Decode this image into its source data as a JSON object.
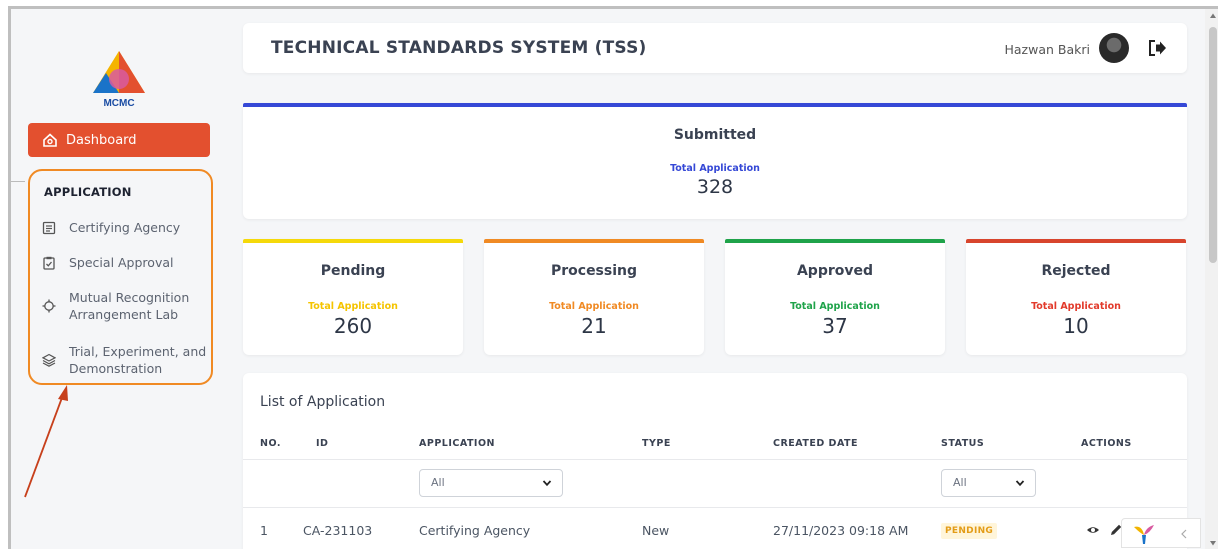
{
  "brand": {
    "logo_text": "MCMC"
  },
  "sidebar": {
    "dashboard_label": "Dashboard",
    "section_title": "APPLICATION",
    "items": [
      {
        "label": "Certifying Agency",
        "icon": "document-icon"
      },
      {
        "label": "Special Approval",
        "icon": "clipboard-check-icon"
      },
      {
        "label": "Mutual Recognition Arrangement Lab",
        "icon": "crosshair-icon"
      },
      {
        "label": "Trial, Experiment, and Demonstration",
        "icon": "layers-icon"
      }
    ]
  },
  "header": {
    "title": "TECHNICAL STANDARDS SYSTEM (TSS)",
    "user_name": "Hazwan Bakri"
  },
  "summary": {
    "submitted": {
      "title": "Submitted",
      "sub": "Total Application",
      "value": "328",
      "color": "#3548d6"
    },
    "pending": {
      "title": "Pending",
      "sub": "Total Application",
      "value": "260",
      "color": "#f5d90a"
    },
    "processing": {
      "title": "Processing",
      "sub": "Total Application",
      "value": "21",
      "color": "#f08a24"
    },
    "approved": {
      "title": "Approved",
      "sub": "Total Application",
      "value": "37",
      "color": "#1fa34a"
    },
    "rejected": {
      "title": "Rejected",
      "sub": "Total Application",
      "value": "10",
      "color": "#d8452d"
    }
  },
  "list": {
    "title": "List of Application",
    "columns": [
      "NO.",
      "ID",
      "APPLICATION",
      "TYPE",
      "CREATED DATE",
      "STATUS",
      "ACTIONS"
    ],
    "filters": {
      "application": "All",
      "status": "All"
    },
    "rows": [
      {
        "no": "1",
        "id": "CA-231103",
        "application": "Certifying Agency",
        "type": "New",
        "created": "27/11/2023 09:18 AM",
        "status": "PENDING"
      }
    ]
  }
}
